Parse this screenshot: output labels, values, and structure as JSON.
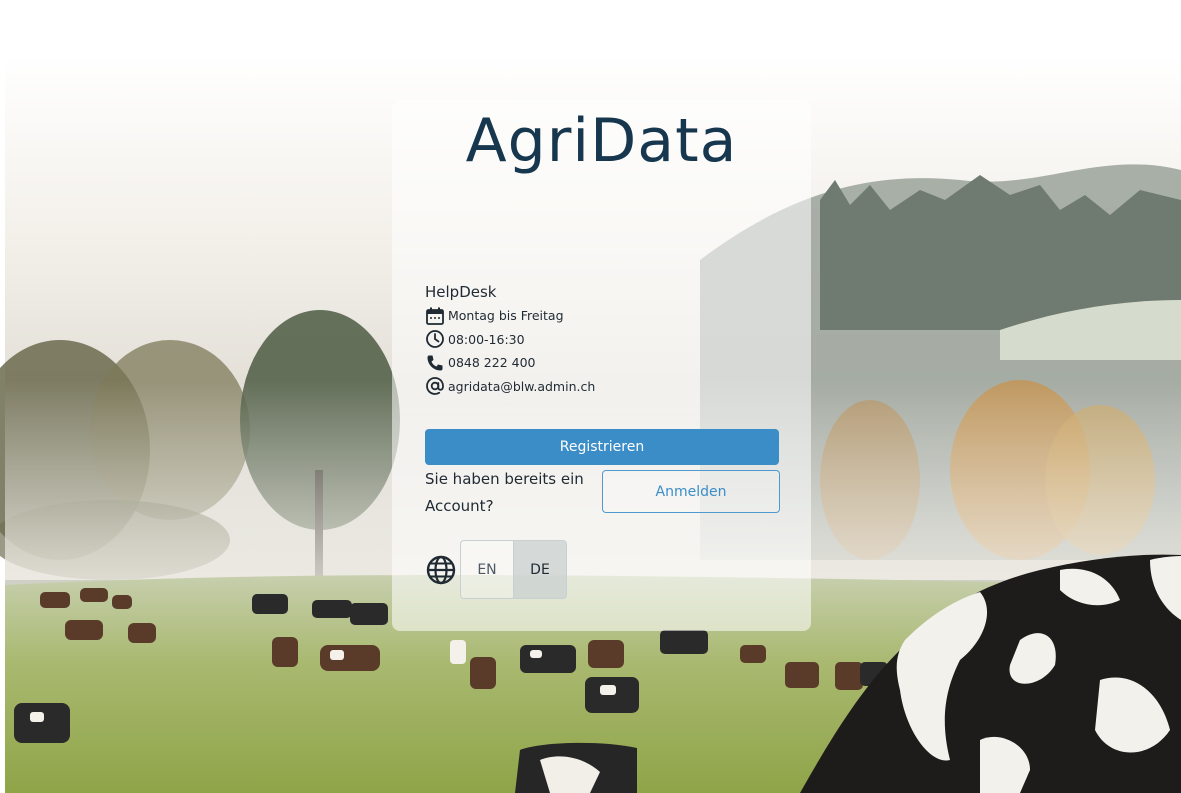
{
  "app": {
    "title": "AgriData"
  },
  "helpdesk": {
    "title": "HelpDesk",
    "days": "Montag bis Freitag",
    "hours": "08:00-16:30",
    "phone": "0848 222 400",
    "email": "agridata@blw.admin.ch",
    "icons": [
      "calendar-icon",
      "clock-icon",
      "phone-icon",
      "at-icon"
    ]
  },
  "actions": {
    "register_label": "Registrieren",
    "account_question": "Sie haben bereits ein Account?",
    "login_label": "Anmelden"
  },
  "language": {
    "options": [
      "EN",
      "DE"
    ],
    "selected": "DE",
    "icon": "globe-icon"
  },
  "colors": {
    "brand": "#17374f",
    "primary": "#3a8dc6"
  }
}
